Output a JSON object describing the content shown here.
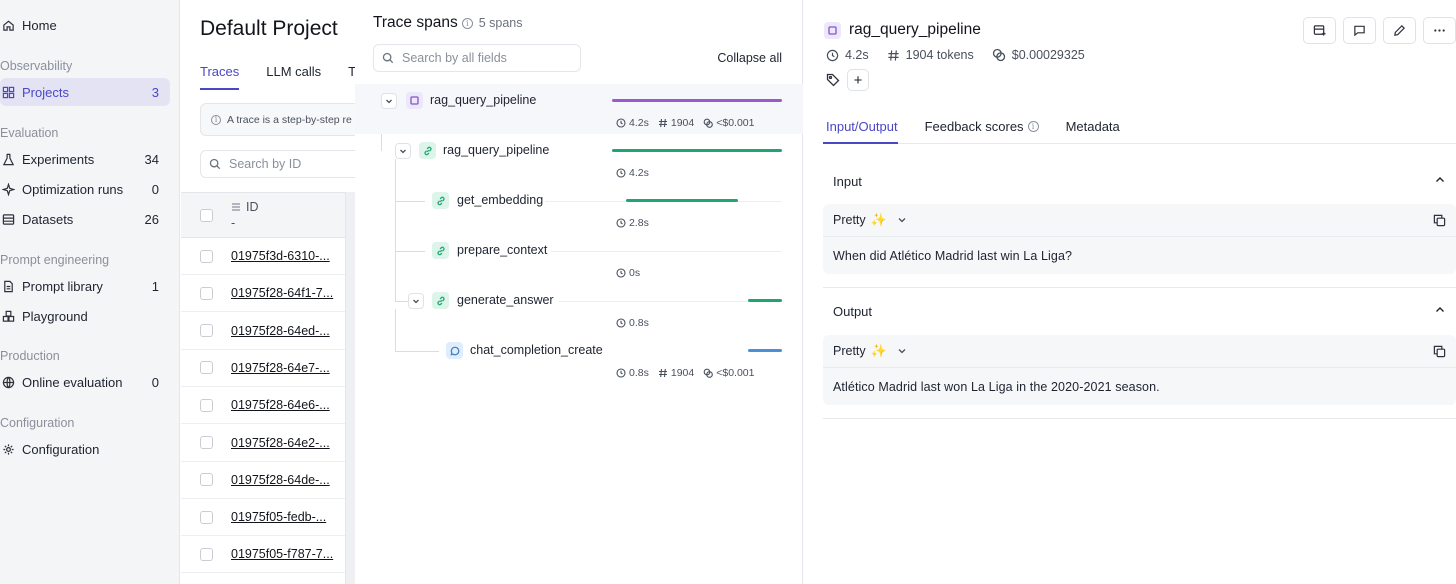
{
  "sidebar": {
    "home_label": "Home",
    "sections": {
      "observability": "Observability",
      "evaluation": "Evaluation",
      "prompt_engineering": "Prompt engineering",
      "production": "Production",
      "configuration": "Configuration"
    },
    "items": {
      "projects": {
        "label": "Projects",
        "count": "3"
      },
      "experiments": {
        "label": "Experiments",
        "count": "34"
      },
      "optimization_runs": {
        "label": "Optimization runs",
        "count": "0"
      },
      "datasets": {
        "label": "Datasets",
        "count": "26"
      },
      "prompt_library": {
        "label": "Prompt library",
        "count": "1"
      },
      "playground": {
        "label": "Playground"
      },
      "online_evaluation": {
        "label": "Online evaluation",
        "count": "0"
      },
      "configuration": {
        "label": "Configuration"
      }
    }
  },
  "project": {
    "title": "Default Project",
    "tabs": [
      "Traces",
      "LLM calls",
      "T"
    ],
    "info_text": "A trace is a step-by-step re",
    "search_placeholder": "Search by ID",
    "id_header": "ID",
    "id_sub": "-",
    "rows": [
      "01975f3d-6310-...",
      "01975f28-64f1-7...",
      "01975f28-64ed-...",
      "01975f28-64e7-...",
      "01975f28-64e6-...",
      "01975f28-64e2-...",
      "01975f28-64de-...",
      "01975f05-fedb-...",
      "01975f05-f787-7..."
    ]
  },
  "trace_spans": {
    "title": "Trace spans",
    "count_label": "5 spans",
    "search_placeholder": "Search by all fields",
    "collapse_label": "Collapse all",
    "spans": [
      {
        "name": "rag_query_pipeline",
        "duration": "4.2s",
        "tokens": "1904",
        "cost": "<$0.001",
        "bar_color": "#9b59d0",
        "bar_start": 0.0,
        "bar_fraction": 1.0
      },
      {
        "name": "rag_query_pipeline",
        "duration": "4.2s",
        "bar_color": "#1ea672",
        "bar_start": 0.0,
        "bar_fraction": 1.0
      },
      {
        "name": "get_embedding",
        "duration": "2.8s",
        "bar_color": "#1ea672",
        "bar_start": 0.08,
        "bar_fraction": 0.66
      },
      {
        "name": "prepare_context",
        "duration": "0s",
        "bar_color": "#1ea672",
        "bar_start": 0.0,
        "bar_fraction": 0.0
      },
      {
        "name": "generate_answer",
        "duration": "0.8s",
        "bar_color": "#1ea672",
        "bar_start": 0.8,
        "bar_fraction": 0.2
      },
      {
        "name": "chat_completion_create",
        "duration": "0.8s",
        "tokens": "1904",
        "cost": "<$0.001",
        "bar_color": "#4a90d9",
        "bar_start": 0.8,
        "bar_fraction": 0.2
      }
    ]
  },
  "detail": {
    "title": "rag_query_pipeline",
    "duration": "4.2s",
    "tokens": "1904 tokens",
    "cost": "$0.00029325",
    "tabs": {
      "io": "Input/Output",
      "feedback": "Feedback scores",
      "metadata": "Metadata"
    },
    "input": {
      "header": "Input",
      "format": "Pretty",
      "text": "When did Atlético Madrid last win La Liga?"
    },
    "output": {
      "header": "Output",
      "format": "Pretty",
      "text": "Atlético Madrid last won La Liga in the 2020-2021 season."
    }
  },
  "colors": {
    "accent": "#4a47c4",
    "span_purple": "#9b59d0",
    "span_green": "#1ea672",
    "span_blue": "#4a90d9"
  }
}
